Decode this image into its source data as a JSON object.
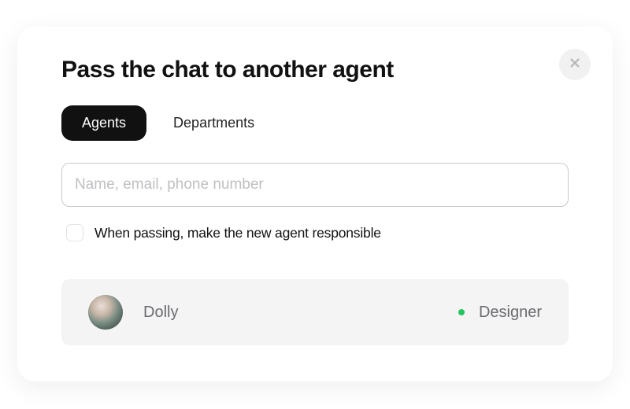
{
  "modal": {
    "title": "Pass the chat to another agent",
    "tabs": [
      {
        "label": "Agents",
        "active": true
      },
      {
        "label": "Departments",
        "active": false
      }
    ],
    "search": {
      "placeholder": "Name, email, phone number",
      "value": ""
    },
    "checkbox": {
      "checked": false,
      "label": "When passing, make the new agent responsible"
    },
    "statusColor": "#22c55e",
    "agents": [
      {
        "name": "Dolly",
        "role": "Designer",
        "status": "online"
      }
    ]
  }
}
